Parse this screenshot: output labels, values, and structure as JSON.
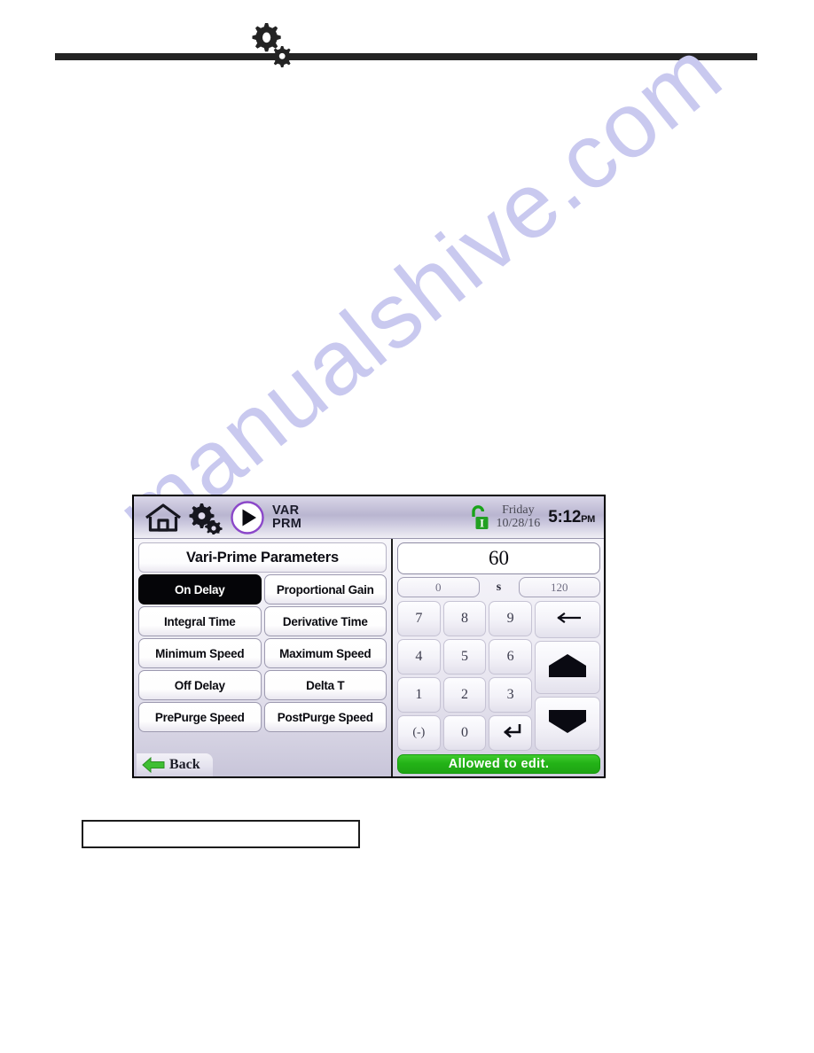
{
  "page": {
    "header_icon": "double-gear-icon",
    "watermark_text": "manualshive.com",
    "caption_text": ""
  },
  "device": {
    "topbar": {
      "home_icon": "home-icon",
      "settings_icon": "gear-icon",
      "play_icon": "play-icon",
      "screen_code_line1": "VAR",
      "screen_code_line2": "PRM",
      "lock_icon": "unlocked-padlock-icon",
      "lock_letter": "I",
      "day": "Friday",
      "date": "10/28/16",
      "time": "5:12",
      "ampm": "PM"
    },
    "left_panel": {
      "title": "Vari-Prime Parameters",
      "parameters": [
        {
          "label": "On Delay",
          "selected": true
        },
        {
          "label": "Proportional Gain",
          "selected": false
        },
        {
          "label": "Integral Time",
          "selected": false
        },
        {
          "label": "Derivative Time",
          "selected": false
        },
        {
          "label": "Minimum Speed",
          "selected": false
        },
        {
          "label": "Maximum Speed",
          "selected": false
        },
        {
          "label": "Off Delay",
          "selected": false
        },
        {
          "label": "Delta T",
          "selected": false
        },
        {
          "label": "PrePurge Speed",
          "selected": false
        },
        {
          "label": "PostPurge Speed",
          "selected": false
        }
      ],
      "back_label": "Back",
      "back_icon": "green-left-arrow-icon"
    },
    "right_panel": {
      "value": "60",
      "min": "0",
      "unit": "s",
      "max": "120",
      "keys": [
        "7",
        "8",
        "9",
        "4",
        "5",
        "6",
        "1",
        "2",
        "3",
        "(-)",
        "0"
      ],
      "enter_icon": "enter-return-icon",
      "backspace_icon": "backspace-arrow-icon",
      "up_icon": "up-arrow-icon",
      "down_icon": "down-arrow-icon",
      "status_text": "Allowed to edit."
    },
    "colors": {
      "status_green": "#23b317",
      "selected_black": "#050508",
      "topbar_purple": "#b9b5d0",
      "lock_green": "#22a022",
      "watermark_purple": "#c9c9ef"
    }
  }
}
